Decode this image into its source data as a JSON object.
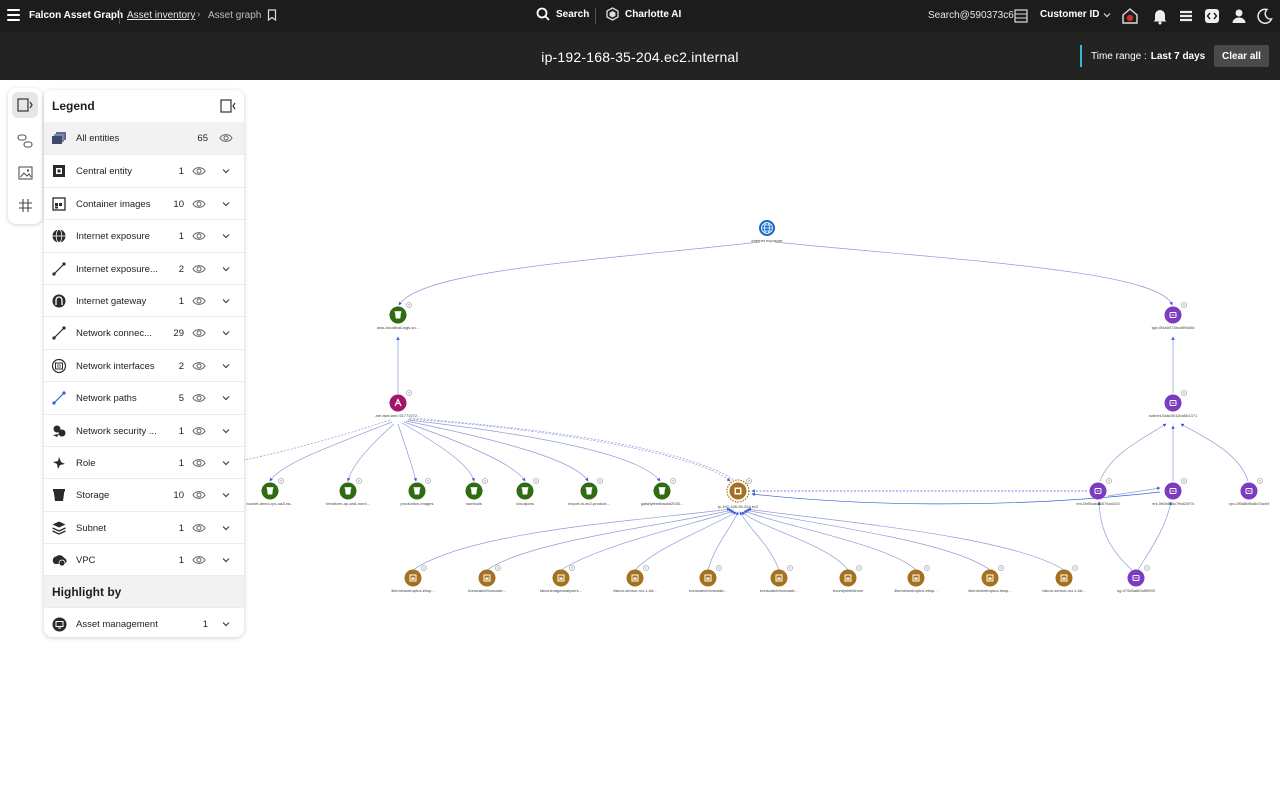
{
  "topbar": {
    "app_name": "Falcon Asset Graph",
    "breadcrumb_link": "Asset inventory",
    "breadcrumb_sep": "›",
    "breadcrumb_current": "Asset graph",
    "search_label": "Search",
    "charlotte_label": "Charlotte AI",
    "search_id": "Search@590373c6",
    "customer_label": "Customer ID"
  },
  "subbar": {
    "title": "ip-192-168-35-204.ec2.internal",
    "time_range_label": "Time range :",
    "time_range_value": "Last 7 days",
    "clear_all": "Clear all"
  },
  "legend": {
    "title": "Legend",
    "all_entities": {
      "label": "All entities",
      "count": "65"
    },
    "items": [
      {
        "label": "Central entity",
        "count": "1",
        "icon": "central-entity-icon"
      },
      {
        "label": "Container images",
        "count": "10",
        "icon": "container-image-icon"
      },
      {
        "label": "Internet exposure",
        "count": "1",
        "icon": "globe-icon"
      },
      {
        "label": "Internet exposure...",
        "count": "2",
        "icon": "connection-line-icon"
      },
      {
        "label": "Internet gateway",
        "count": "1",
        "icon": "gateway-icon"
      },
      {
        "label": "Network connec...",
        "count": "29",
        "icon": "connection-line-icon"
      },
      {
        "label": "Network interfaces",
        "count": "2",
        "icon": "network-interface-icon"
      },
      {
        "label": "Network paths",
        "count": "5",
        "icon": "network-path-icon"
      },
      {
        "label": "Network security ...",
        "count": "1",
        "icon": "security-group-icon"
      },
      {
        "label": "Role",
        "count": "1",
        "icon": "role-icon"
      },
      {
        "label": "Storage",
        "count": "10",
        "icon": "bucket-icon"
      },
      {
        "label": "Subnet",
        "count": "1",
        "icon": "subnet-icon"
      },
      {
        "label": "VPC",
        "count": "1",
        "icon": "vpc-icon"
      }
    ],
    "highlight_title": "Highlight by",
    "highlight_items": [
      {
        "label": "Asset management",
        "count": "1"
      }
    ]
  },
  "colors": {
    "topbar": "#1c1c1c",
    "subbar": "#232323",
    "accent_cyan": "#2fb9d6",
    "storage_green": "#2e6b12",
    "role_magenta": "#a1166b",
    "network_purple": "#7d3bbf",
    "container_gold": "#a5711f",
    "internet_blue": "#1669c7",
    "edge_blue": "#3c5fd6"
  },
  "graph": {
    "nodes": [
      {
        "id": "internet",
        "type": "internet",
        "label": "internet exposure"
      },
      {
        "id": "bucket-top",
        "type": "storage",
        "label": "aws-cloudtrail-logs-sn..."
      },
      {
        "id": "igw",
        "type": "network",
        "label": "igw-0f4a0074bca9f4d0d"
      },
      {
        "id": "role",
        "type": "role",
        "label": "arn:aws:iam::51771072..."
      },
      {
        "id": "subnet",
        "type": "network",
        "label": "subnet-0a8c0011ba5b1371"
      },
      {
        "id": "b1",
        "type": "storage",
        "label": "bucket-demo-rpc-sa2ura..."
      },
      {
        "id": "b2",
        "type": "storage",
        "label": "terraform-up-and-runni..."
      },
      {
        "id": "b3",
        "type": "storage",
        "label": "production-images"
      },
      {
        "id": "b4",
        "type": "storage",
        "label": "ssmtools"
      },
      {
        "id": "b5",
        "type": "storage",
        "label": "cloudjoins"
      },
      {
        "id": "b6",
        "type": "storage",
        "label": "import-to-ec2-product..."
      },
      {
        "id": "b7",
        "type": "storage",
        "label": "gatsbyfeedbackd2035..."
      },
      {
        "id": "central",
        "type": "central",
        "label": "ip-192-168-35-204.ec2"
      },
      {
        "id": "eni1",
        "type": "network",
        "label": "eni-0bf5cab28379a4103"
      },
      {
        "id": "eni2",
        "type": "network",
        "label": "eni-0b0b5c4c7fbd24f74"
      },
      {
        "id": "vpc",
        "type": "network",
        "label": "vpc-0f5d8bf5a5d7acb9"
      },
      {
        "id": "c1",
        "type": "container",
        "label": "likeminiontruptux-eksp..."
      },
      {
        "id": "c2",
        "type": "container",
        "label": "bonscatch/boncastr..."
      },
      {
        "id": "c3",
        "type": "container",
        "label": "falconimageanalyzers..."
      },
      {
        "id": "c4",
        "type": "container",
        "label": "falcon-sensor-rux-1-fal..."
      },
      {
        "id": "c5",
        "type": "container",
        "label": "bonscatch/boncastr..."
      },
      {
        "id": "c6",
        "type": "container",
        "label": "bonscatch/boncastr..."
      },
      {
        "id": "c7",
        "type": "container",
        "label": "bountyshieldmon"
      },
      {
        "id": "c8",
        "type": "container",
        "label": "likeminiontruptux-eksp..."
      },
      {
        "id": "c9",
        "type": "container",
        "label": "likeminiontruptux-eksp..."
      },
      {
        "id": "c10",
        "type": "container",
        "label": "falcon-sensor-rux-1-fal..."
      },
      {
        "id": "sg",
        "type": "network",
        "label": "sg-079d3a6f2a5f0f93"
      }
    ]
  }
}
